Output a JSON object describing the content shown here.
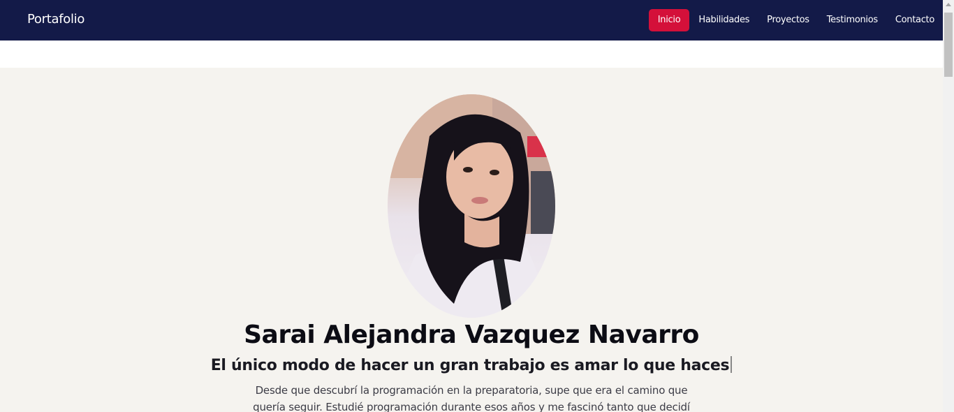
{
  "navbar": {
    "brand": "Portafolio",
    "links": [
      {
        "label": "Inicio",
        "active": true
      },
      {
        "label": "Habilidades",
        "active": false
      },
      {
        "label": "Proyectos",
        "active": false
      },
      {
        "label": "Testimonios",
        "active": false
      },
      {
        "label": "Contacto",
        "active": false
      }
    ]
  },
  "hero": {
    "name": "Sarai Alejandra Vazquez Navarro",
    "tagline": "El único modo de hacer un gran trabajo es amar lo que haces",
    "bio": "Desde que descubrí la programación en la preparatoria, supe que era el camino que quería seguir. Estudié programación durante esos años y me fascinó tanto que decidí continuar mi"
  },
  "colors": {
    "navbar_bg": "#131a48",
    "active_link_bg": "#d4103a",
    "hero_bg": "#f5f3ef"
  }
}
